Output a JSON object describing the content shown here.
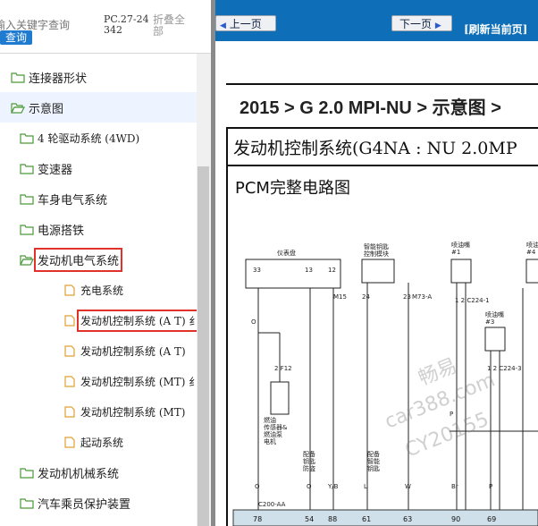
{
  "left_panel": {
    "search": {
      "placeholder": "输入关键字查询"
    },
    "query_button": "查询",
    "pc_code": "PC.27-24342",
    "collapse_all": "折叠全部",
    "tree": [
      {
        "label": "连接器形状",
        "level": 0,
        "icon": "folder-closed-icon"
      },
      {
        "label": "示意图",
        "level": 0,
        "icon": "folder-open-icon",
        "selected": true
      },
      {
        "label": "4 轮驱动系统 (4WD)",
        "level": 1,
        "icon": "folder-closed-icon"
      },
      {
        "label": "变速器",
        "level": 1,
        "icon": "folder-closed-icon"
      },
      {
        "label": "车身电气系统",
        "level": 1,
        "icon": "folder-closed-icon"
      },
      {
        "label": "电源搭铁",
        "level": 1,
        "icon": "folder-closed-icon"
      },
      {
        "label": "发动机电气系统",
        "level": 1,
        "icon": "folder-open-icon",
        "highlighted": true
      },
      {
        "label": "充电系统",
        "level": 2,
        "icon": "document-icon"
      },
      {
        "label": "发动机控制系统 (A T) 纟",
        "level": 2,
        "icon": "document-icon",
        "highlighted": true
      },
      {
        "label": "发动机控制系统 (A T)",
        "level": 2,
        "icon": "document-icon"
      },
      {
        "label": "发动机控制系统 (MT) 纟",
        "level": 2,
        "icon": "document-icon"
      },
      {
        "label": "发动机控制系统 (MT)",
        "level": 2,
        "icon": "document-icon"
      },
      {
        "label": "起动系统",
        "level": 2,
        "icon": "document-icon"
      },
      {
        "label": "发动机机械系统",
        "level": 1,
        "icon": "folder-closed-icon"
      },
      {
        "label": "汽车乘员保护装置",
        "level": 1,
        "icon": "folder-closed-icon"
      }
    ]
  },
  "right_panel": {
    "nav": {
      "prev": "上一页",
      "next": "下一页",
      "refresh": "[刷新当前页]"
    },
    "page_title": "2015 > G 2.0 MPI-NU > 示意图 >",
    "system_title": "发动机控制系统(G4NA : NU 2.0MP",
    "diagram_title": "PCM完整电路图",
    "schematic": {
      "components": [
        "仪表盘",
        "智能钥匙控制模块",
        "喷油嘴 #1",
        "喷油嘴 #3",
        "喷油嘴 #4",
        "燃油传感器&燃油泵电机"
      ],
      "pins": [
        "33",
        "13",
        "12",
        "M15",
        "24",
        "23",
        "M73-A",
        "1",
        "2",
        "C224-1",
        "C224-3",
        "2",
        "F12",
        "C200-AA"
      ],
      "wire_colors": [
        "O",
        "O",
        "Y/B",
        "L",
        "W",
        "Br",
        "P",
        "O"
      ],
      "small_labels": [
        "配备钥匙防盗",
        "配备智能钥匙"
      ],
      "bottom_pins": [
        "78",
        "54",
        "88",
        "61",
        "63",
        "90",
        "69"
      ]
    },
    "watermark": [
      "畅易",
      "car388.com",
      "CY20155"
    ]
  },
  "colors": {
    "nav_bar": "#0e6fb8",
    "highlight": "#e0312b",
    "query_button": "#1f7bd0",
    "divider": "#8a8a8a"
  }
}
